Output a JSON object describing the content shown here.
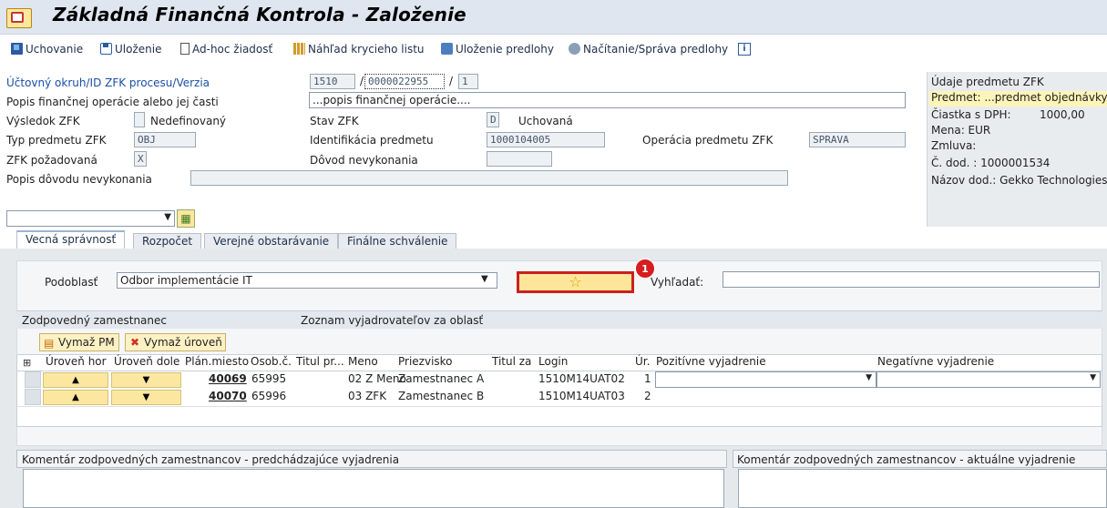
{
  "app": {
    "title": "Základná Finančná Kontrola - Založenie"
  },
  "toolbar": {
    "store": "Uchovanie",
    "save": "Uloženie",
    "adhoc": "Ad-hoc žiadosť",
    "preview": "Náhľad krycieho listu",
    "save_template": "Uloženie predlohy",
    "load_template": "Načítanie/Správa predlohy"
  },
  "header": {
    "process_label": "Účtovný okruh/ID ZFK procesu/Verzia",
    "company_code": "1510",
    "process_id": "0000022955",
    "version": "1",
    "sep1": "/",
    "sep2": "/",
    "desc_label": "Popis finančnej operácie alebo jej časti",
    "desc_value": "...popis finančnej operácie....",
    "result_label": "Výsledok ZFK",
    "result_value": "Nedefinovaný",
    "status_label": "Stav ZFK",
    "status_code": "D",
    "status_value": "Uchovaná",
    "type_label": "Typ predmetu ZFK",
    "type_value": "OBJ",
    "ident_label": "Identifikácia predmetu",
    "ident_value": "1000104005",
    "op_label": "Operácia predmetu ZFK",
    "op_value": "SPRAVA",
    "required_label": "ZFK požadovaná",
    "required_value": "X",
    "reason_label": "Dôvod nevykonania",
    "reason_desc_label": "Popis dôvodu nevykonania"
  },
  "side": {
    "title": "Údaje predmetu ZFK",
    "subject": "Predmet: ...predmet objednávky",
    "amount_label": "Čiastka s DPH:",
    "amount": "1000,00",
    "currency": "Mena: EUR",
    "contract": "Zmluva:",
    "supplier_no": "Č. dod. : 1000001534",
    "supplier_name": "Názov dod.: Gekko Technologies"
  },
  "tabs": [
    "Vecná správnosť",
    "Rozpočet",
    "Verejné obstarávanie",
    "Finálne schválenie"
  ],
  "subarea": {
    "label": "Podoblasť",
    "value": "Odbor implementácie IT",
    "search_label": "Vyhľadať:",
    "badge": "1"
  },
  "employees": {
    "section_label": "Zodpovedný zamestnanec",
    "list_label": "Zoznam vyjadrovateľov za oblasť",
    "del_pm": "Vymaž PM",
    "del_level": "Vymaž úroveň",
    "columns": [
      "Úroveň hor",
      "Úroveň dole",
      "Plán.miesto",
      "Osob.č.",
      "Titul pr...",
      "Meno",
      "Priezvisko",
      "Titul za",
      "Login",
      "Úr.",
      "Pozitívne vyjadrenie",
      "Negatívne vyjadrenie"
    ],
    "rows": [
      {
        "plan": "40069",
        "osob": "65995",
        "meno": "02 Z Meno",
        "priezvisko": "Zamestnanec A",
        "login": "1510M14UAT02",
        "ur": "1"
      },
      {
        "plan": "40070",
        "osob": "65996",
        "meno": "03 ZFK",
        "priezvisko": "Zamestnanec B",
        "login": "1510M14UAT03",
        "ur": "2"
      }
    ]
  },
  "comments": {
    "prev": "Komentár zodpovedných zamestnancov - predchádzajúce vyjadrenia",
    "current": "Komentár zodpovedných zamestnancov - aktuálne vyjadrenie"
  }
}
